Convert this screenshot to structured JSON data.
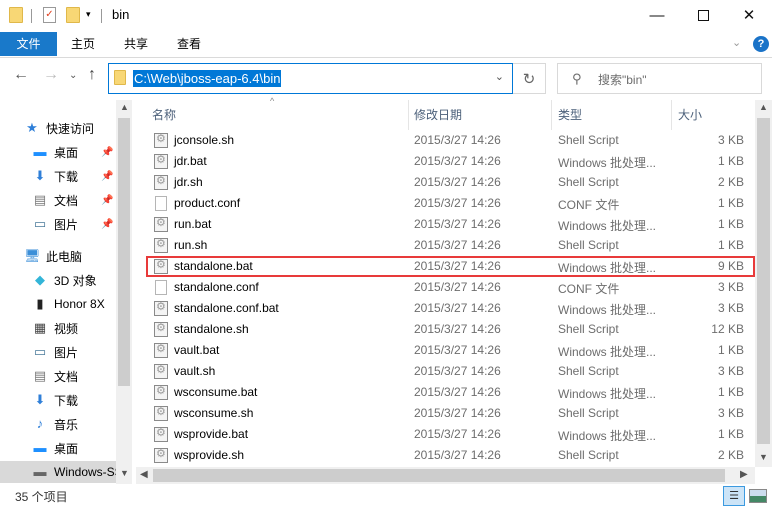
{
  "window": {
    "title": "bin",
    "minimize_icon": "minimize-icon",
    "maximize_icon": "maximize-icon",
    "close_icon": "close-icon"
  },
  "ribbon": {
    "tabs": [
      {
        "label": "文件"
      },
      {
        "label": "主页"
      },
      {
        "label": "共享"
      },
      {
        "label": "查看"
      }
    ]
  },
  "address": {
    "path": "C:\\Web\\jboss-eap-6.4\\bin"
  },
  "search": {
    "placeholder": "搜索\"bin\""
  },
  "sidebar": {
    "items": [
      {
        "label": "快速访问",
        "icon": "star-icon",
        "pinned": false
      },
      {
        "label": "桌面",
        "icon": "desktop-icon",
        "pinned": true
      },
      {
        "label": "下载",
        "icon": "download-icon",
        "pinned": true
      },
      {
        "label": "文档",
        "icon": "document-icon",
        "pinned": true
      },
      {
        "label": "图片",
        "icon": "picture-icon",
        "pinned": true
      },
      {
        "label": "此电脑",
        "icon": "computer-icon",
        "pinned": false
      },
      {
        "label": "3D 对象",
        "icon": "cube-icon",
        "pinned": false
      },
      {
        "label": "Honor 8X",
        "icon": "phone-icon",
        "pinned": false
      },
      {
        "label": "视频",
        "icon": "video-icon",
        "pinned": false
      },
      {
        "label": "图片",
        "icon": "picture-icon",
        "pinned": false
      },
      {
        "label": "文档",
        "icon": "document-icon",
        "pinned": false
      },
      {
        "label": "下载",
        "icon": "download-icon",
        "pinned": false
      },
      {
        "label": "音乐",
        "icon": "music-icon",
        "pinned": false
      },
      {
        "label": "桌面",
        "icon": "desktop-icon",
        "pinned": false
      },
      {
        "label": "Windows-SSD",
        "icon": "drive-icon",
        "pinned": false,
        "selected": true
      }
    ]
  },
  "columns": {
    "name": "名称",
    "date": "修改日期",
    "type": "类型",
    "size": "大小"
  },
  "files": [
    {
      "name": "jconsole.sh",
      "date": "2015/3/27 14:26",
      "type": "Shell Script",
      "size": "3 KB",
      "icon": "script"
    },
    {
      "name": "jdr.bat",
      "date": "2015/3/27 14:26",
      "type": "Windows 批处理...",
      "size": "1 KB",
      "icon": "script"
    },
    {
      "name": "jdr.sh",
      "date": "2015/3/27 14:26",
      "type": "Shell Script",
      "size": "2 KB",
      "icon": "script"
    },
    {
      "name": "product.conf",
      "date": "2015/3/27 14:26",
      "type": "CONF 文件",
      "size": "1 KB",
      "icon": "plain"
    },
    {
      "name": "run.bat",
      "date": "2015/3/27 14:26",
      "type": "Windows 批处理...",
      "size": "1 KB",
      "icon": "script"
    },
    {
      "name": "run.sh",
      "date": "2015/3/27 14:26",
      "type": "Shell Script",
      "size": "1 KB",
      "icon": "script"
    },
    {
      "name": "standalone.bat",
      "date": "2015/3/27 14:26",
      "type": "Windows 批处理...",
      "size": "9 KB",
      "icon": "script",
      "highlighted": true
    },
    {
      "name": "standalone.conf",
      "date": "2015/3/27 14:26",
      "type": "CONF 文件",
      "size": "3 KB",
      "icon": "plain"
    },
    {
      "name": "standalone.conf.bat",
      "date": "2015/3/27 14:26",
      "type": "Windows 批处理...",
      "size": "3 KB",
      "icon": "script"
    },
    {
      "name": "standalone.sh",
      "date": "2015/3/27 14:26",
      "type": "Shell Script",
      "size": "12 KB",
      "icon": "script"
    },
    {
      "name": "vault.bat",
      "date": "2015/3/27 14:26",
      "type": "Windows 批处理...",
      "size": "1 KB",
      "icon": "script"
    },
    {
      "name": "vault.sh",
      "date": "2015/3/27 14:26",
      "type": "Shell Script",
      "size": "3 KB",
      "icon": "script"
    },
    {
      "name": "wsconsume.bat",
      "date": "2015/3/27 14:26",
      "type": "Windows 批处理...",
      "size": "1 KB",
      "icon": "script"
    },
    {
      "name": "wsconsume.sh",
      "date": "2015/3/27 14:26",
      "type": "Shell Script",
      "size": "3 KB",
      "icon": "script"
    },
    {
      "name": "wsprovide.bat",
      "date": "2015/3/27 14:26",
      "type": "Windows 批处理...",
      "size": "1 KB",
      "icon": "script"
    },
    {
      "name": "wsprovide.sh",
      "date": "2015/3/27 14:26",
      "type": "Shell Script",
      "size": "2 KB",
      "icon": "script"
    }
  ],
  "status": {
    "item_count": "35 个项目"
  },
  "colors": {
    "accent": "#0078d7",
    "file_tab": "#1979ca",
    "highlight_border": "#e83a3a"
  }
}
